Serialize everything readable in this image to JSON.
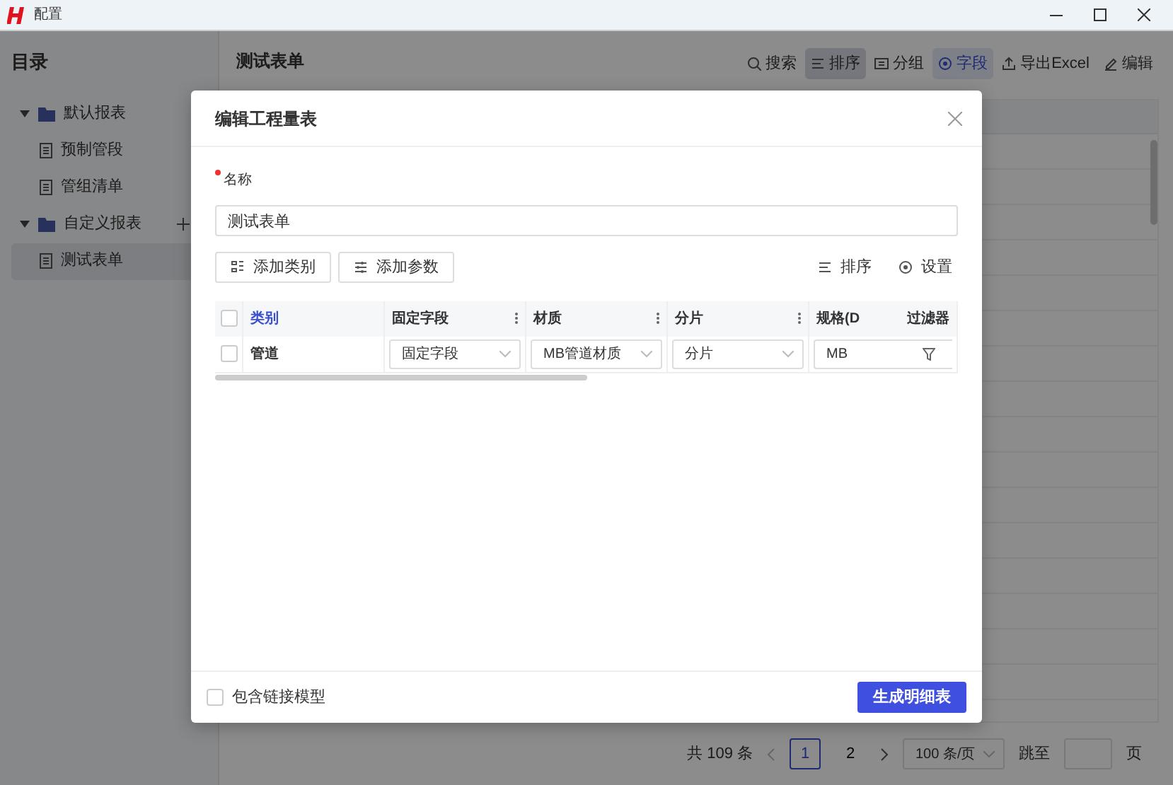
{
  "window": {
    "title": "配置"
  },
  "sidebar": {
    "title": "目录",
    "tree": [
      {
        "label": "默认报表",
        "expanded": true,
        "addable": false,
        "children": [
          {
            "label": "预制管段",
            "selected": false
          },
          {
            "label": "管组清单",
            "selected": false
          }
        ]
      },
      {
        "label": "自定义报表",
        "expanded": true,
        "addable": true,
        "children": [
          {
            "label": "测试表单",
            "selected": true
          }
        ]
      }
    ]
  },
  "main": {
    "title": "测试表单",
    "toolbar": [
      {
        "label": "搜索",
        "highlighted": false,
        "selected": false
      },
      {
        "label": "排序",
        "highlighted": true,
        "selected": false
      },
      {
        "label": "分组",
        "highlighted": false,
        "selected": false
      },
      {
        "label": "字段",
        "highlighted": false,
        "selected": true
      },
      {
        "label": "导出Excel",
        "highlighted": false,
        "selected": false
      },
      {
        "label": "编辑",
        "highlighted": false,
        "selected": false
      }
    ],
    "pagination": {
      "total": "共 109 条",
      "pages": [
        {
          "label": "1",
          "selected": true
        },
        {
          "label": "2",
          "selected": false
        }
      ],
      "page_size": "100 条/页",
      "jump_label": "跳至",
      "jump_unit": "页"
    }
  },
  "dialog": {
    "title": "编辑工程量表",
    "name_label": "名称",
    "name_required": true,
    "name_value": "测试表单",
    "buttons": [
      {
        "label": "添加类别"
      },
      {
        "label": "添加参数"
      }
    ],
    "actions": [
      {
        "label": "排序"
      },
      {
        "label": "设置"
      }
    ],
    "table": {
      "header_checked": false,
      "columns": [
        {
          "label": "类别",
          "menu": false
        },
        {
          "label": "固定字段",
          "menu": true
        },
        {
          "label": "材质",
          "menu": true
        },
        {
          "label": "分片",
          "menu": true
        },
        {
          "label": "规格(D",
          "menu": false
        }
      ],
      "filter_label": "过滤器",
      "rows": [
        {
          "checked": false,
          "cells": [
            {
              "kind": "text",
              "value": "管道"
            },
            {
              "kind": "select",
              "value": "固定字段"
            },
            {
              "kind": "select",
              "value": "MB管道材质"
            },
            {
              "kind": "select",
              "value": "分片"
            },
            {
              "kind": "filter",
              "value": "MB"
            }
          ]
        }
      ]
    },
    "footer": {
      "checkbox": {
        "label": "包含链接模型",
        "checked": false
      },
      "primary_button": "生成明细表"
    }
  }
}
